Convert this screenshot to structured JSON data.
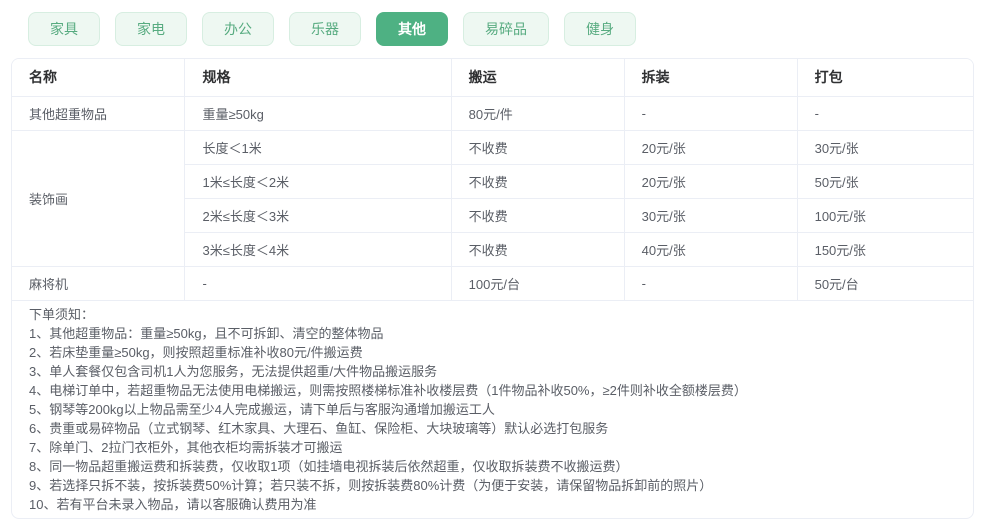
{
  "colors": {
    "accent_green": "#4eb183",
    "tab_inactive_bg": "#eef8f2",
    "tab_inactive_border": "#d7eee1",
    "tab_inactive_text": "#57ab80",
    "table_border": "#ebeef5",
    "header_text": "#303133",
    "cell_text": "#5a5e66"
  },
  "tabs": [
    {
      "label": "家具",
      "active": false
    },
    {
      "label": "家电",
      "active": false
    },
    {
      "label": "办公",
      "active": false
    },
    {
      "label": "乐器",
      "active": false
    },
    {
      "label": "其他",
      "active": true
    },
    {
      "label": "易碎品",
      "active": false
    },
    {
      "label": "健身",
      "active": false
    }
  ],
  "table": {
    "headers": [
      "名称",
      "规格",
      "搬运",
      "拆装",
      "打包"
    ],
    "rows": [
      {
        "name": "其他超重物品",
        "specs": [
          {
            "spec": "重量≥50kg",
            "move": "80元/件",
            "disassemble": "-",
            "pack": "-"
          }
        ]
      },
      {
        "name": "装饰画",
        "specs": [
          {
            "spec": "长度＜1米",
            "move": "不收费",
            "disassemble": "20元/张",
            "pack": "30元/张"
          },
          {
            "spec": "1米≤长度＜2米",
            "move": "不收费",
            "disassemble": "20元/张",
            "pack": "50元/张"
          },
          {
            "spec": "2米≤长度＜3米",
            "move": "不收费",
            "disassemble": "30元/张",
            "pack": "100元/张"
          },
          {
            "spec": "3米≤长度＜4米",
            "move": "不收费",
            "disassemble": "40元/张",
            "pack": "150元/张"
          }
        ]
      },
      {
        "name": "麻将机",
        "specs": [
          {
            "spec": "-",
            "move": "100元/台",
            "disassemble": "-",
            "pack": "50元/台"
          }
        ]
      }
    ]
  },
  "notes": {
    "title": "下单须知：",
    "items": [
      "1、其他超重物品：重量≥50kg，且不可拆卸、清空的整体物品",
      "2、若床垫重量≥50kg，则按照超重标准补收80元/件搬运费",
      "3、单人套餐仅包含司机1人为您服务，无法提供超重/大件物品搬运服务",
      "4、电梯订单中，若超重物品无法使用电梯搬运，则需按照楼梯标准补收楼层费（1件物品补收50%，≥2件则补收全额楼层费）",
      "5、钢琴等200kg以上物品需至少4人完成搬运，请下单后与客服沟通增加搬运工人",
      "6、贵重或易碎物品（立式钢琴、红木家具、大理石、鱼缸、保险柜、大块玻璃等）默认必选打包服务",
      "7、除单门、2拉门衣柜外，其他衣柜均需拆装才可搬运",
      "8、同一物品超重搬运费和拆装费，仅收取1项（如挂墙电视拆装后依然超重，仅收取拆装费不收搬运费）",
      "9、若选择只拆不装，按拆装费50%计算；若只装不拆，则按拆装费80%计费（为便于安装，请保留物品拆卸前的照片）",
      "10、若有平台未录入物品，请以客服确认费用为准"
    ]
  }
}
